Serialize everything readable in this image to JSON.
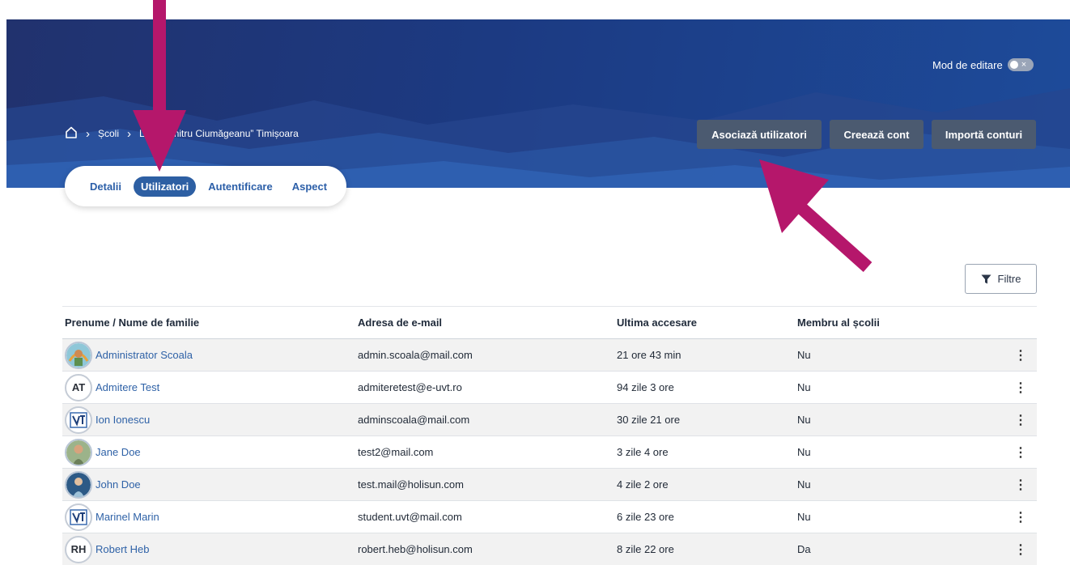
{
  "header": {
    "edit_mode_label": "Mod de editare",
    "toggle_off_symbol": "×",
    "breadcrumb": {
      "home_icon": "home-icon",
      "items": [
        "Școli",
        "L.I. „Dumitru Ciumăgeanu” Timișoara"
      ]
    },
    "buttons": {
      "associate": "Asociază utilizatori",
      "create": "Creează cont",
      "import": "Importă conturi"
    }
  },
  "tabs": [
    {
      "label": "Detalii",
      "active": false
    },
    {
      "label": "Utilizatori",
      "active": true
    },
    {
      "label": "Autentificare",
      "active": false
    },
    {
      "label": "Aspect",
      "active": false
    }
  ],
  "filter_label": "Filtre",
  "table": {
    "headers": [
      "Prenume / Nume de familie",
      "Adresa de e-mail",
      "Ultima accesare",
      "Membru al școlii"
    ],
    "rows": [
      {
        "initials": "",
        "avatar": "photo-rainbow",
        "name": "Administrator Scoala",
        "email": "admin.scoala@mail.com",
        "last": "21 ore 43 min",
        "member": "Nu"
      },
      {
        "initials": "AT",
        "avatar": "initials",
        "name": "Admitere Test",
        "email": "admiteretest@e-uvt.ro",
        "last": "94 zile 3 ore",
        "member": "Nu"
      },
      {
        "initials": "",
        "avatar": "uvt-logo",
        "name": "Ion Ionescu",
        "email": "adminscoala@mail.com",
        "last": "30 zile 21 ore",
        "member": "Nu"
      },
      {
        "initials": "",
        "avatar": "photo-woman",
        "name": "Jane Doe",
        "email": "test2@mail.com",
        "last": "3 zile 4 ore",
        "member": "Nu"
      },
      {
        "initials": "",
        "avatar": "photo-man",
        "name": "John Doe",
        "email": "test.mail@holisun.com",
        "last": "4 zile 2 ore",
        "member": "Nu"
      },
      {
        "initials": "",
        "avatar": "uvt-logo",
        "name": "Marinel Marin",
        "email": "student.uvt@mail.com",
        "last": "6 zile 23 ore",
        "member": "Nu"
      },
      {
        "initials": "RH",
        "avatar": "initials",
        "name": "Robert Heb",
        "email": "robert.heb@holisun.com",
        "last": "8 zile 22 ore",
        "member": "Da"
      }
    ],
    "row_menu_symbol": "⋮"
  },
  "colors": {
    "hero": "#1d3a80",
    "accent": "#2d5fa3",
    "annotation_arrow": "#b5176b"
  }
}
